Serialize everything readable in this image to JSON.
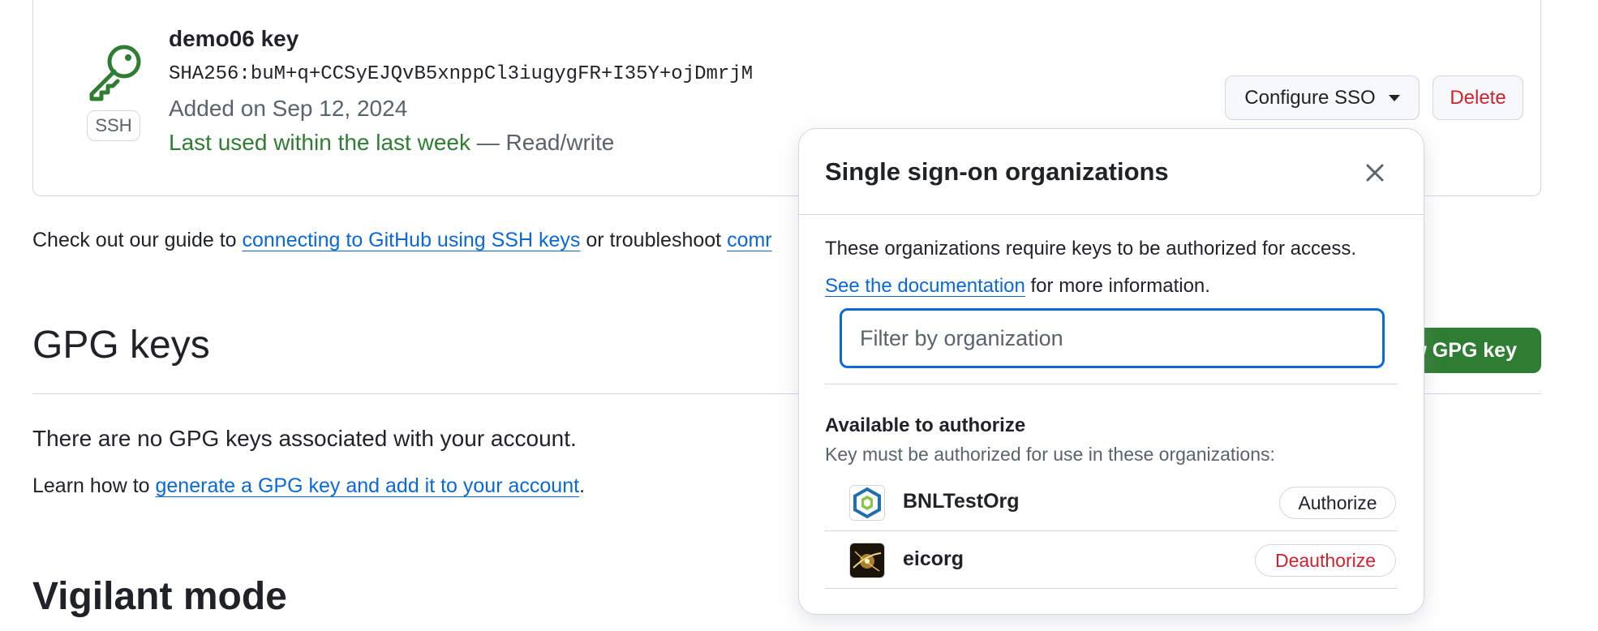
{
  "ssh_key": {
    "badge": "SSH",
    "title": "demo06 key",
    "fingerprint": "SHA256:buM+q+CCSyEJQvB5xnppCl3iugygFR+I35Y+ojDmrjM",
    "added": "Added on Sep 12, 2024",
    "last_used": "Last used within the last week",
    "access": "— Read/write",
    "configure_sso_label": "Configure SSO",
    "delete_label": "Delete"
  },
  "guide": {
    "prefix": "Check out our guide to ",
    "link1": "connecting to GitHub using SSH keys",
    "middle": " or troubleshoot ",
    "link2_partial": "comr"
  },
  "gpg": {
    "heading": "GPG keys",
    "new_button_label": "ew GPG key",
    "empty_text": "There are no GPG keys associated with your account.",
    "learn_prefix": "Learn how to ",
    "learn_link": "generate a GPG key and add it to your account",
    "learn_suffix": "."
  },
  "vigilant": {
    "heading": "Vigilant mode"
  },
  "sso_popover": {
    "title": "Single sign-on organizations",
    "description": "These organizations require keys to be authorized for access.",
    "doc_link": "See the documentation",
    "doc_suffix": " for more information.",
    "filter_placeholder": "Filter by organization",
    "available_title": "Available to authorize",
    "available_subtitle": "Key must be authorized for use in these organizations:",
    "orgs": [
      {
        "name": "BNLTestOrg",
        "action": "Authorize"
      },
      {
        "name": "eicorg",
        "action": "Deauthorize"
      }
    ]
  },
  "colors": {
    "link": "#0969da",
    "success": "#2f7d32",
    "danger": "#cf222e",
    "muted": "#59636e",
    "border": "#d0d7de"
  }
}
